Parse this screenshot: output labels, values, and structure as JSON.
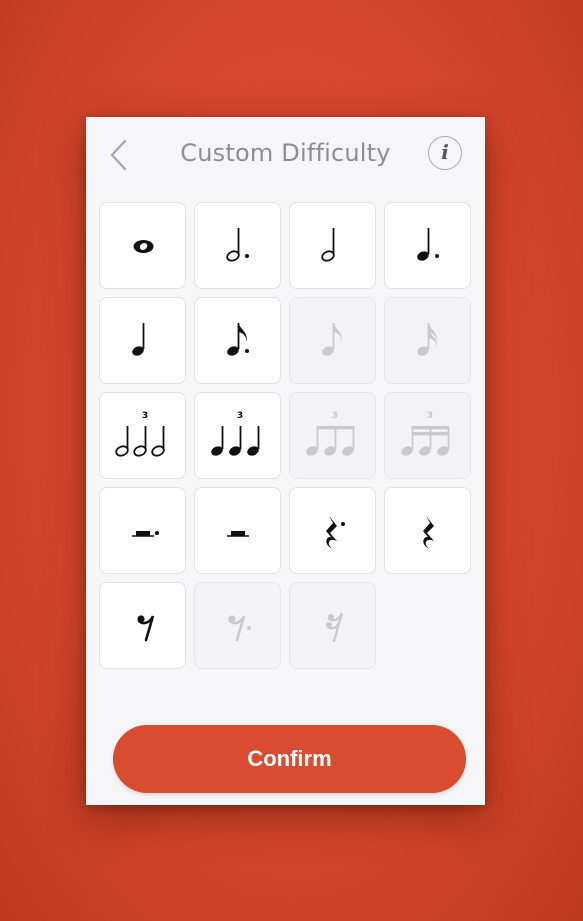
{
  "header": {
    "title": "Custom Difficulty",
    "info_icon_label": "i",
    "back_icon": "chevron-left-icon"
  },
  "notes": [
    {
      "name": "whole-note-icon",
      "enabled": true
    },
    {
      "name": "dotted-half-note-icon",
      "enabled": true
    },
    {
      "name": "half-note-icon",
      "enabled": true
    },
    {
      "name": "dotted-quarter-note-icon",
      "enabled": true
    },
    {
      "name": "quarter-note-icon",
      "enabled": true
    },
    {
      "name": "dotted-eighth-note-icon",
      "enabled": true
    },
    {
      "name": "eighth-note-icon",
      "enabled": false
    },
    {
      "name": "sixteenth-note-icon",
      "enabled": false
    },
    {
      "name": "half-note-triplet-icon",
      "enabled": true,
      "tuplet": "3"
    },
    {
      "name": "quarter-note-triplet-icon",
      "enabled": true,
      "tuplet": "3"
    },
    {
      "name": "eighth-note-triplet-icon",
      "enabled": false,
      "tuplet": "3"
    },
    {
      "name": "sixteenth-note-triplet-icon",
      "enabled": false,
      "tuplet": "3"
    },
    {
      "name": "dotted-half-rest-icon",
      "enabled": true
    },
    {
      "name": "half-rest-icon",
      "enabled": true
    },
    {
      "name": "dotted-quarter-rest-icon",
      "enabled": true
    },
    {
      "name": "quarter-rest-icon",
      "enabled": true
    },
    {
      "name": "eighth-rest-icon",
      "enabled": true
    },
    {
      "name": "dotted-eighth-rest-icon",
      "enabled": false
    },
    {
      "name": "sixteenth-rest-icon",
      "enabled": false
    }
  ],
  "confirm_label": "Confirm",
  "colors": {
    "background": "#d8472c",
    "accent": "#d94c2f",
    "enabled_ink": "#111111",
    "disabled_ink": "#c9c9cf"
  }
}
